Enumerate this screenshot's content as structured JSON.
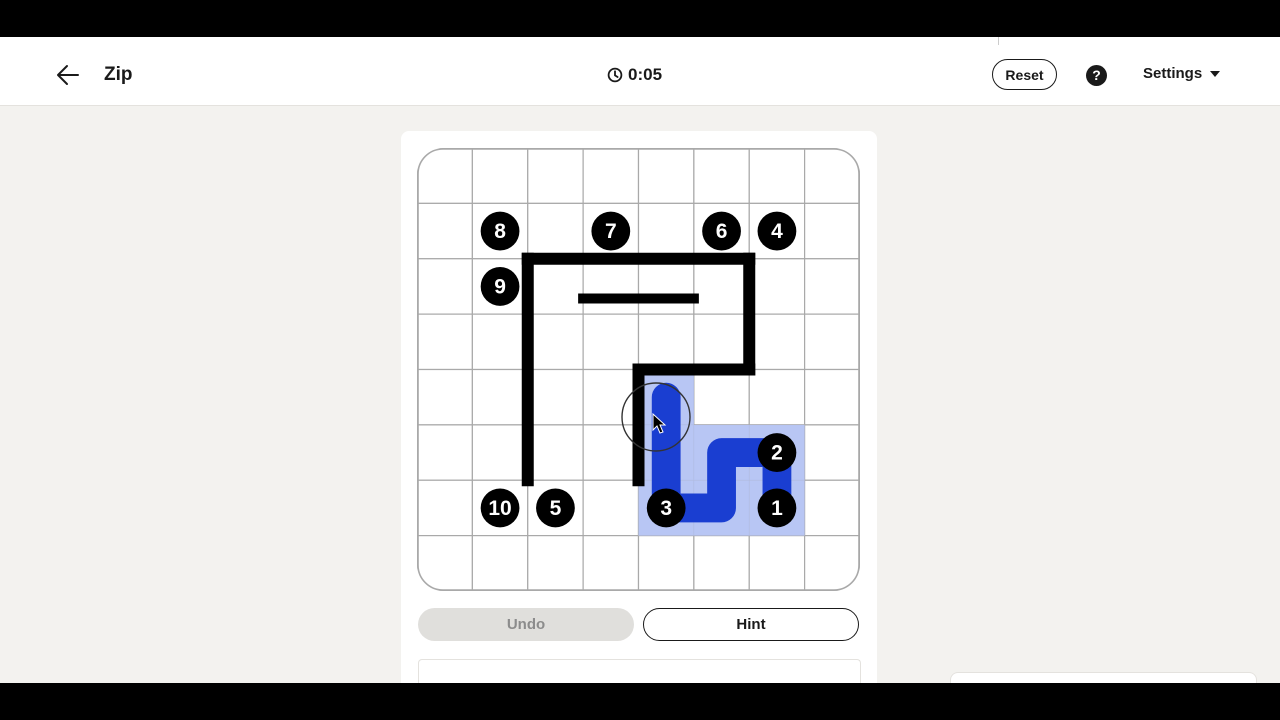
{
  "header": {
    "title": "Zip",
    "timer": "0:05",
    "reset_label": "Reset",
    "help_label": "?",
    "settings_label": "Settings"
  },
  "icons": {
    "back": "arrow-left-icon",
    "timer": "clock-icon",
    "help": "question-icon",
    "settings_caret": "caret-down-icon"
  },
  "puzzle": {
    "rows": 8,
    "cols": 8,
    "numbers": [
      {
        "label": "8",
        "row": 1,
        "col": 1
      },
      {
        "label": "7",
        "row": 1,
        "col": 3
      },
      {
        "label": "6",
        "row": 1,
        "col": 5
      },
      {
        "label": "4",
        "row": 1,
        "col": 6
      },
      {
        "label": "9",
        "row": 2,
        "col": 1
      },
      {
        "label": "2",
        "row": 5,
        "col": 6
      },
      {
        "label": "10",
        "row": 6,
        "col": 1
      },
      {
        "label": "5",
        "row": 6,
        "col": 2
      },
      {
        "label": "3",
        "row": 6,
        "col": 4
      },
      {
        "label": "1",
        "row": 6,
        "col": 6
      }
    ],
    "path": [
      [
        6,
        6
      ],
      [
        5,
        6
      ],
      [
        5,
        5
      ],
      [
        6,
        5
      ],
      [
        6,
        4
      ],
      [
        5,
        4
      ],
      [
        4,
        4
      ]
    ],
    "walls": [
      {
        "v": "h",
        "line": 2,
        "from": 2,
        "to": 6
      },
      {
        "v": "v",
        "line": 2,
        "from": 2,
        "to": 6
      },
      {
        "v": "v",
        "line": 6,
        "from": 2,
        "to": 4
      },
      {
        "v": "h",
        "line": 4,
        "from": 4,
        "to": 6
      },
      {
        "v": "v",
        "line": 4,
        "from": 4,
        "to": 6
      },
      {
        "v": "hs",
        "line": 3,
        "from": 3,
        "to": 5
      }
    ],
    "colors": {
      "path": "#1a3ed1",
      "path_fill": "#b4c3f3",
      "wall": "#000000",
      "grid": "#a9a9a9",
      "number_bg": "#000000",
      "number_text": "#ffffff"
    }
  },
  "actions": {
    "undo_label": "Undo",
    "hint_label": "Hint"
  }
}
